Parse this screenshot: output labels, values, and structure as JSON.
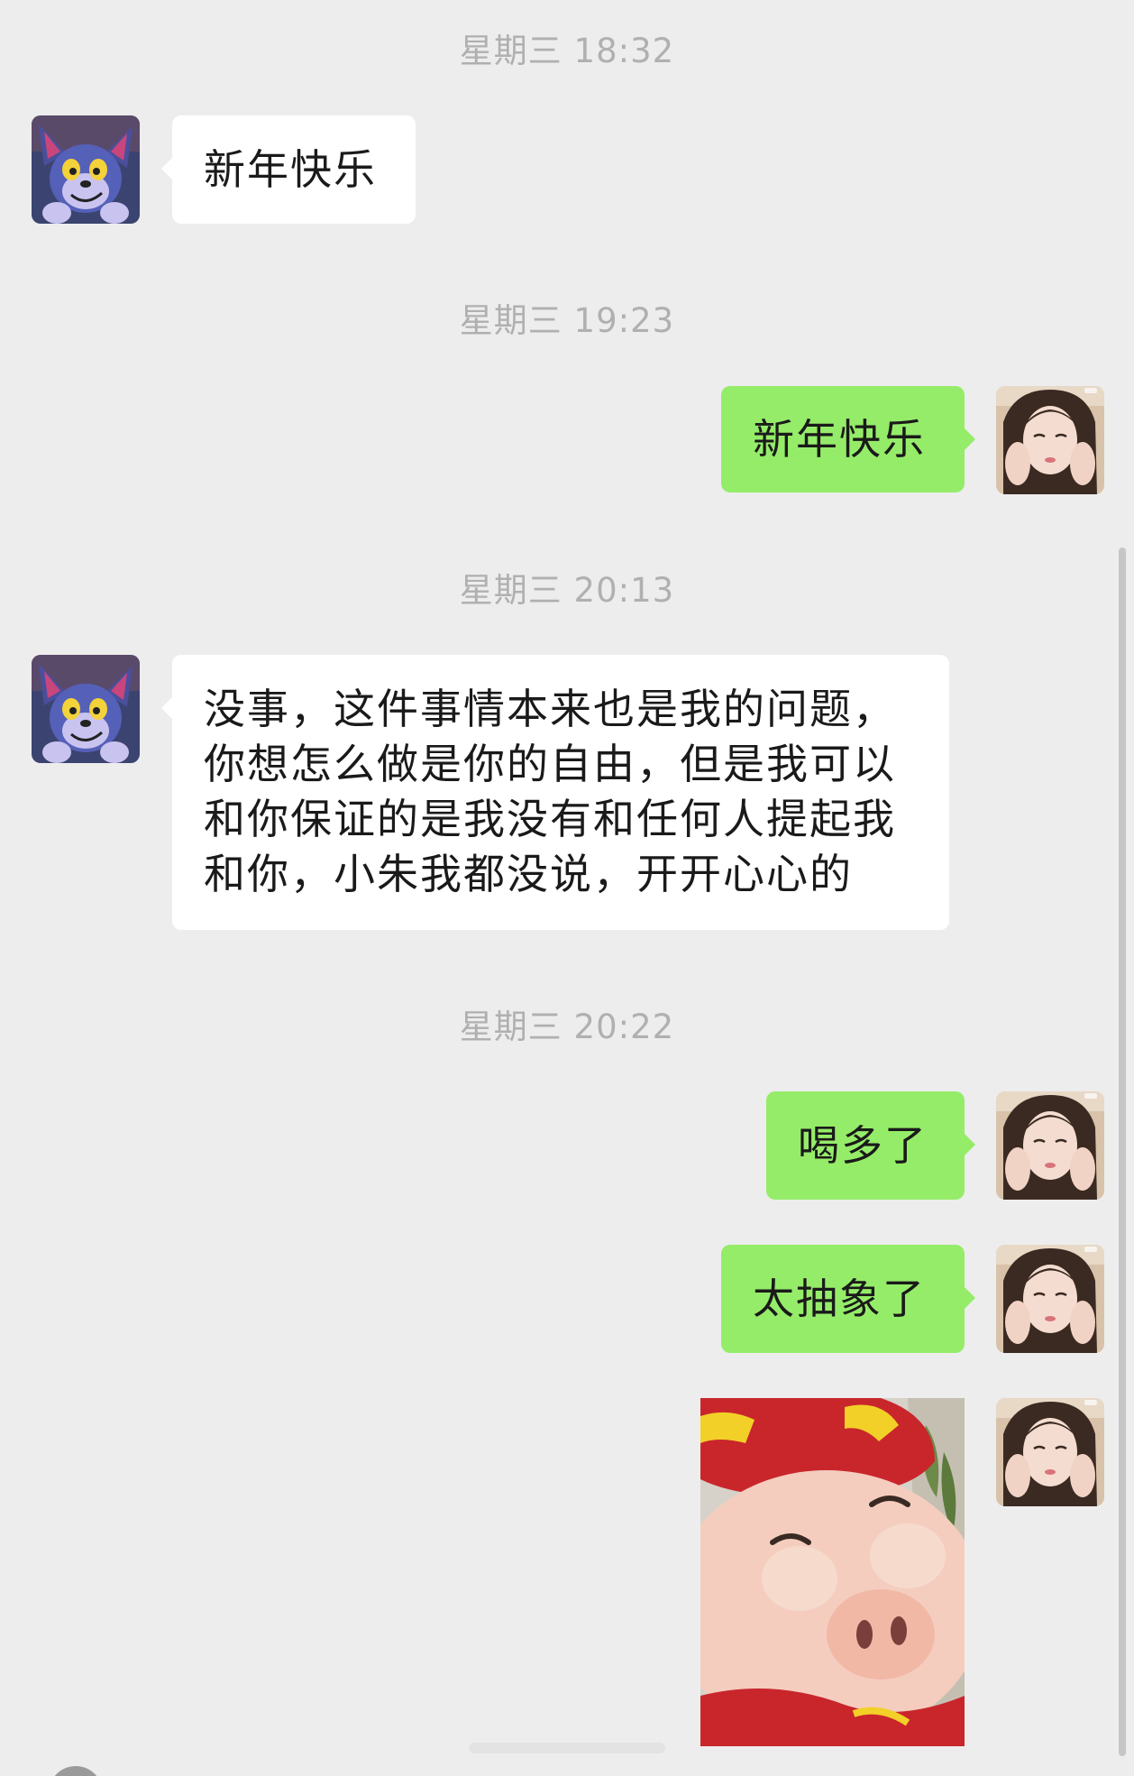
{
  "chat": {
    "timestamps": [
      "星期三 18:32",
      "星期三 19:23",
      "星期三 20:13",
      "星期三 20:22"
    ],
    "messages": [
      {
        "from": "contact",
        "text": "新年快乐"
      },
      {
        "from": "me",
        "text": "新年快乐"
      },
      {
        "from": "contact",
        "lines": [
          "没事，这件事情本来也是我的问题，",
          "你想怎么做是你的自由，但是我可以",
          "和你保证的是我没有和任何人提起我",
          "和你，小朱我都没说，开开心心的"
        ]
      },
      {
        "from": "me",
        "text": "喝多了"
      },
      {
        "from": "me",
        "text": "太抽象了"
      },
      {
        "from": "me",
        "sticker": "pig-cartoon-sticker"
      }
    ]
  },
  "colors": {
    "background": "#ededed",
    "incoming_bubble": "#ffffff",
    "outgoing_bubble": "#95ec69",
    "timestamp_text": "#b0b0b0"
  }
}
